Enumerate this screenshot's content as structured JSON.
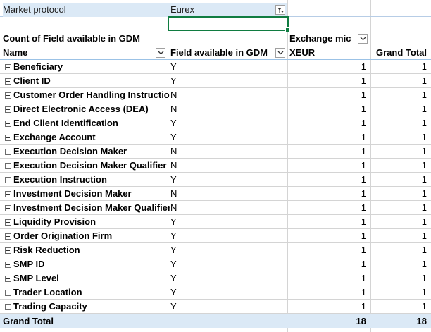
{
  "filters": [
    {
      "label": "Market protocol",
      "value": "Eurex"
    }
  ],
  "pivot": {
    "values_caption": "Count of Field available in GDM",
    "column_field": "Exchange mic",
    "row_field_1": "Name",
    "row_field_2": "Field available in GDM",
    "column_item": "XEUR",
    "grand_total_header": "Grand Total",
    "rows": [
      {
        "name": "Beneficiary",
        "gdm": "Y",
        "xeur": "1",
        "total": "1"
      },
      {
        "name": "Client ID",
        "gdm": "Y",
        "xeur": "1",
        "total": "1"
      },
      {
        "name": "Customer Order Handling Instruction",
        "gdm": "N",
        "xeur": "1",
        "total": "1"
      },
      {
        "name": "Direct Electronic Access (DEA)",
        "gdm": "N",
        "xeur": "1",
        "total": "1"
      },
      {
        "name": "End Client Identification",
        "gdm": "Y",
        "xeur": "1",
        "total": "1"
      },
      {
        "name": "Exchange Account",
        "gdm": "Y",
        "xeur": "1",
        "total": "1"
      },
      {
        "name": "Execution Decision Maker",
        "gdm": "N",
        "xeur": "1",
        "total": "1"
      },
      {
        "name": "Execution Decision Maker Qualifier",
        "gdm": "N",
        "xeur": "1",
        "total": "1"
      },
      {
        "name": "Execution Instruction",
        "gdm": "Y",
        "xeur": "1",
        "total": "1"
      },
      {
        "name": "Investment Decision Maker",
        "gdm": "N",
        "xeur": "1",
        "total": "1"
      },
      {
        "name": "Investment Decision Maker Qualifier",
        "gdm": "N",
        "xeur": "1",
        "total": "1"
      },
      {
        "name": "Liquidity Provision",
        "gdm": "Y",
        "xeur": "1",
        "total": "1"
      },
      {
        "name": "Order Origination Firm",
        "gdm": "Y",
        "xeur": "1",
        "total": "1"
      },
      {
        "name": "Risk Reduction",
        "gdm": "Y",
        "xeur": "1",
        "total": "1"
      },
      {
        "name": "SMP ID",
        "gdm": "Y",
        "xeur": "1",
        "total": "1"
      },
      {
        "name": "SMP Level",
        "gdm": "Y",
        "xeur": "1",
        "total": "1"
      },
      {
        "name": "Trader Location",
        "gdm": "Y",
        "xeur": "1",
        "total": "1"
      },
      {
        "name": "Trading Capacity",
        "gdm": "Y",
        "xeur": "1",
        "total": "1"
      }
    ],
    "grand_total_label": "Grand Total",
    "grand_total_xeur": "18",
    "grand_total_all": "18"
  },
  "icons": {
    "filter_active": "filter-dropdown-icon",
    "dropdown": "chevron-down-icon",
    "collapse": "collapse-minus-icon"
  },
  "colors": {
    "header_band": "#dbe9f6",
    "border_blue": "#9bc2e6",
    "selection_green": "#107c41"
  }
}
